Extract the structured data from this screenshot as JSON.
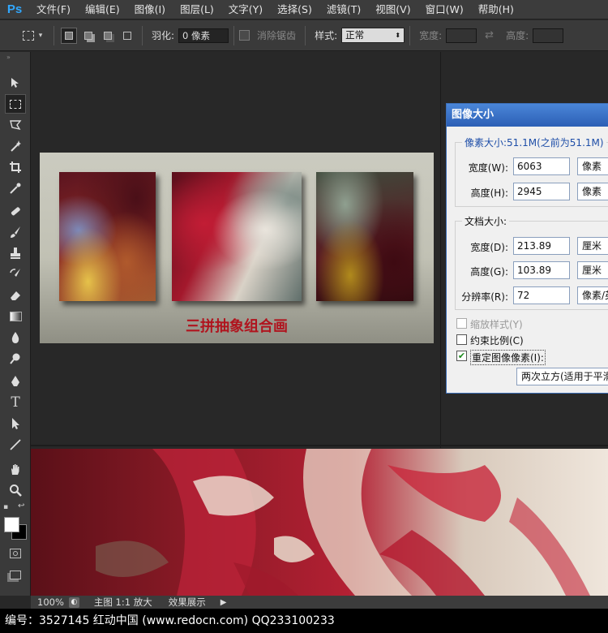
{
  "app": {
    "logo": "Ps"
  },
  "menu": [
    "文件(F)",
    "编辑(E)",
    "图像(I)",
    "图层(L)",
    "文字(Y)",
    "选择(S)",
    "滤镜(T)",
    "视图(V)",
    "窗口(W)",
    "帮助(H)"
  ],
  "options": {
    "feather_label": "羽化:",
    "feather_value": "0 像素",
    "antialias_label": "消除锯齿",
    "style_label": "样式:",
    "style_value": "正常",
    "width_label": "宽度:",
    "height_label": "高度:"
  },
  "artwork": {
    "caption": "三拼抽象组合画"
  },
  "dialog": {
    "title": "图像大小",
    "pixel_size_label": "像素大小:51.1M(之前为51.1M)",
    "width_label": "宽度(W):",
    "width_value": "6063",
    "width_unit": "像素",
    "height_label": "高度(H):",
    "height_value": "2945",
    "height_unit": "像素",
    "doc_size_label": "文档大小:",
    "doc_width_label": "宽度(D):",
    "doc_width_value": "213.89",
    "doc_width_unit": "厘米",
    "doc_height_label": "高度(G):",
    "doc_height_value": "103.89",
    "doc_height_unit": "厘米",
    "resolution_label": "分辨率(R):",
    "resolution_value": "72",
    "resolution_unit": "像素/英寸",
    "scale_styles_label": "缩放样式(Y)",
    "constrain_label": "约束比例(C)",
    "resample_label": "重定图像像素(I):",
    "resample_value": "两次立方(适用于平滑渐变)"
  },
  "status": {
    "zoom": "100%",
    "tab_main": "主图 1:1 放大",
    "tab_effect": "效果展示"
  },
  "caption": "编号：3527145    红动中国 (www.redocn.com)    QQ233100233"
}
